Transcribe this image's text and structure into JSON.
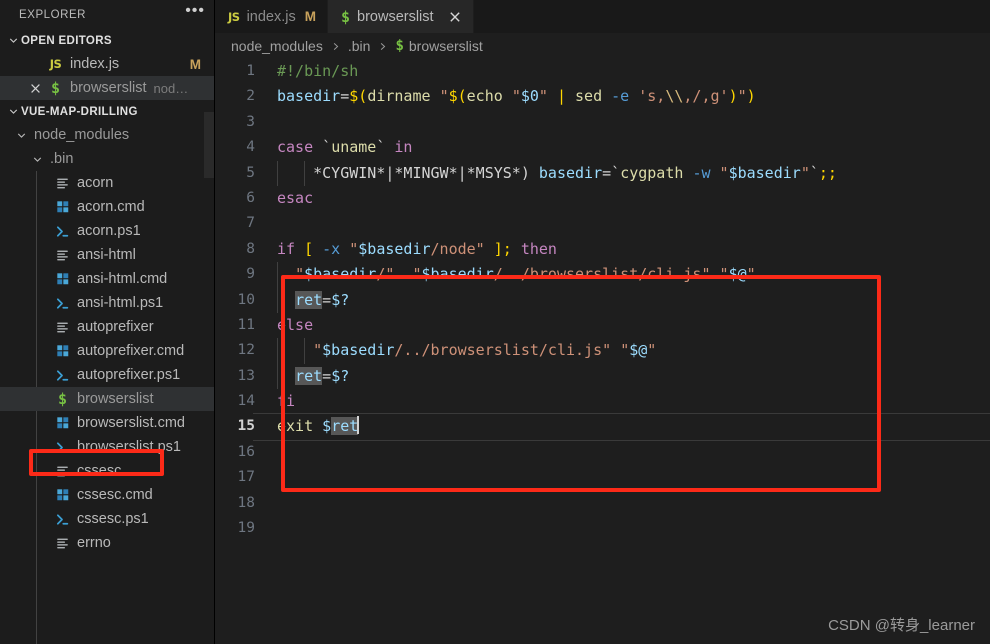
{
  "window": {
    "theme_bg": "#1e1e1e",
    "sidebar_bg": "#1c1c1c",
    "accent_annotation": "#fc2a18"
  },
  "sidebar": {
    "header": {
      "title": "EXPLORER",
      "more_label": "•••",
      "more_icon": "ellipsis-icon"
    },
    "sections": [
      {
        "label": "OPEN EDITORS",
        "expanded": true
      },
      {
        "label": "VUE-MAP-DRILLING",
        "expanded": true
      }
    ],
    "open_editors": [
      {
        "name": "index.js",
        "icon": "js-file-icon",
        "badge": "M",
        "suffix": "",
        "selected": false,
        "close": false
      },
      {
        "name": "browserslist",
        "icon": "shell-file-icon",
        "badge": "",
        "suffix": "nod…",
        "selected": true,
        "close": true
      }
    ],
    "tree": [
      {
        "label": "node_modules",
        "icon": "chevron-down-icon",
        "kind": "folder",
        "indent": 1
      },
      {
        "label": ".bin",
        "icon": "chevron-down-icon",
        "kind": "folder",
        "indent": 2
      },
      {
        "label": "acorn",
        "icon": "text-file-icon",
        "kind": "file",
        "indent": 3
      },
      {
        "label": "acorn.cmd",
        "icon": "windows-cmd-icon",
        "kind": "file",
        "indent": 3
      },
      {
        "label": "acorn.ps1",
        "icon": "powershell-icon",
        "kind": "file",
        "indent": 3
      },
      {
        "label": "ansi-html",
        "icon": "text-file-icon",
        "kind": "file",
        "indent": 3
      },
      {
        "label": "ansi-html.cmd",
        "icon": "windows-cmd-icon",
        "kind": "file",
        "indent": 3
      },
      {
        "label": "ansi-html.ps1",
        "icon": "powershell-icon",
        "kind": "file",
        "indent": 3
      },
      {
        "label": "autoprefixer",
        "icon": "text-file-icon",
        "kind": "file",
        "indent": 3
      },
      {
        "label": "autoprefixer.cmd",
        "icon": "windows-cmd-icon",
        "kind": "file",
        "indent": 3
      },
      {
        "label": "autoprefixer.ps1",
        "icon": "powershell-icon",
        "kind": "file",
        "indent": 3
      },
      {
        "label": "browserslist",
        "icon": "shell-file-icon",
        "kind": "file",
        "indent": 3,
        "selected": true,
        "annotated": true
      },
      {
        "label": "browserslist.cmd",
        "icon": "windows-cmd-icon",
        "kind": "file",
        "indent": 3
      },
      {
        "label": "browserslist.ps1",
        "icon": "powershell-icon",
        "kind": "file",
        "indent": 3
      },
      {
        "label": "cssesc",
        "icon": "text-file-icon",
        "kind": "file",
        "indent": 3
      },
      {
        "label": "cssesc.cmd",
        "icon": "windows-cmd-icon",
        "kind": "file",
        "indent": 3
      },
      {
        "label": "cssesc.ps1",
        "icon": "powershell-icon",
        "kind": "file",
        "indent": 3
      },
      {
        "label": "errno",
        "icon": "text-file-icon",
        "kind": "file",
        "indent": 3
      }
    ]
  },
  "editor": {
    "tabs": [
      {
        "label": "index.js",
        "icon": "js-file-icon",
        "modified_badge": "M",
        "active": false,
        "closable": false
      },
      {
        "label": "browserslist",
        "icon": "shell-file-icon",
        "modified_badge": "",
        "active": true,
        "closable": true,
        "close_icon": "close-icon"
      }
    ],
    "breadcrumb": [
      {
        "label": "node_modules",
        "icon": ""
      },
      {
        "label": ".bin",
        "icon": ""
      },
      {
        "label": "browserslist",
        "icon": "shell-file-icon"
      }
    ],
    "breadcrumb_separator": "›",
    "active_line": 15,
    "cursor_line": 15,
    "cursor_column": 10,
    "total_lines_visible": 19,
    "word_occurrence_highlight": "ret",
    "lines": [
      {
        "n": 1,
        "text": "#!/bin/sh"
      },
      {
        "n": 2,
        "text": "basedir=$(dirname \"$(echo \"$0\" | sed -e 's,\\\\,/,g')\")"
      },
      {
        "n": 3,
        "text": ""
      },
      {
        "n": 4,
        "text": "case `uname` in"
      },
      {
        "n": 5,
        "text": "    *CYGWIN*|*MINGW*|*MSYS*) basedir=`cygpath -w \"$basedir\"`;;"
      },
      {
        "n": 6,
        "text": "esac"
      },
      {
        "n": 7,
        "text": ""
      },
      {
        "n": 8,
        "text": "if [ -x \"$basedir/node\" ]; then"
      },
      {
        "n": 9,
        "text": "  \"$basedir/\"  \"$basedir/../browserslist/cli.js\" \"$@\""
      },
      {
        "n": 10,
        "text": "  ret=$?"
      },
      {
        "n": 11,
        "text": "else"
      },
      {
        "n": 12,
        "text": "    \"$basedir/../browserslist/cli.js\" \"$@\""
      },
      {
        "n": 13,
        "text": "  ret=$?"
      },
      {
        "n": 14,
        "text": "fi"
      },
      {
        "n": 15,
        "text": "exit $ret"
      },
      {
        "n": 16,
        "text": ""
      },
      {
        "n": 17,
        "text": ""
      },
      {
        "n": 18,
        "text": ""
      },
      {
        "n": 19,
        "text": ""
      }
    ]
  },
  "annotations": [
    {
      "name": "code-block-highlight",
      "target": "editor lines 8-15",
      "color": "#fc2a18"
    },
    {
      "name": "file-highlight",
      "target": "sidebar browserslist",
      "color": "#fc2a18"
    }
  ],
  "watermark": {
    "text": "CSDN @转身_learner"
  }
}
